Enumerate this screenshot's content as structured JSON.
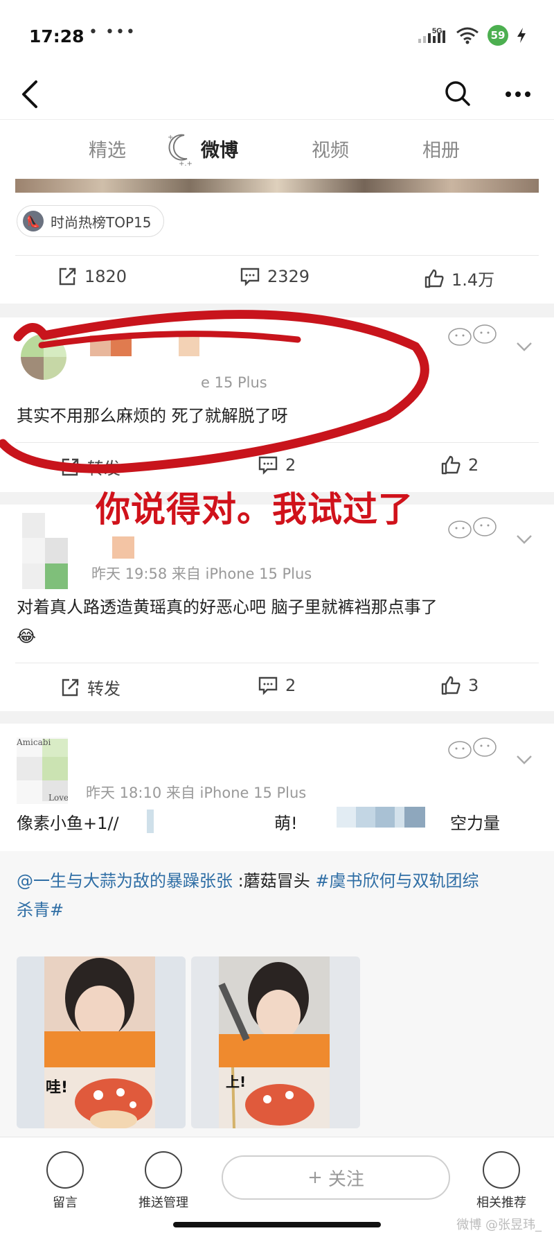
{
  "status_bar": {
    "time": "17:28",
    "dots": "• •••",
    "network": "5G",
    "battery": "59"
  },
  "tabs": [
    {
      "label": "精选"
    },
    {
      "label": "微博"
    },
    {
      "label": "视频"
    },
    {
      "label": "相册"
    }
  ],
  "top_post": {
    "topic_chip": "时尚热榜TOP15",
    "repost_count": "1820",
    "comment_count": "2329",
    "like_count": "1.4万"
  },
  "comment1": {
    "meta": "e 15 Plus",
    "text": "其实不用那么麻烦的 死了就解脱了呀",
    "repost_label": "转发",
    "comment_count": "2",
    "like_count": "2"
  },
  "annotation": {
    "text": "你说得对。我试过了",
    "color": "#d0121b"
  },
  "comment2": {
    "meta": "昨天 19:58  来自 iPhone 15 Plus",
    "text": "对着真人路透造黄瑶真的好恶心吧 脑子里就裤裆那点事了",
    "emoji": "😂",
    "repost_label": "转发",
    "comment_count": "2",
    "like_count": "3"
  },
  "comment3": {
    "avatar_text_top": "Amicabi",
    "avatar_text_bottom": "Love",
    "meta": "昨天 18:10  来自 iPhone 15 Plus",
    "text_start": "像素小鱼+1//",
    "text_mid": "萌!",
    "text_end": "空力量",
    "repost_user": "@一生与大蒜为敌的暴躁张张",
    "repost_body": " :蘑菇冒头 ",
    "repost_tag1": "#虞书欣何与双轨团综",
    "repost_tag2": "杀青#",
    "thumb1_caption": "哇!",
    "thumb2_caption": "上!"
  },
  "bottom_bar": {
    "message_label": "留言",
    "push_label": "推送管理",
    "follow_label": "关注",
    "follow_plus": "+",
    "related_label": "相关推荐",
    "watermark": "微博 @张昱玮_"
  },
  "colors": {
    "link": "#2f6ea5",
    "annotation": "#d0121b"
  }
}
